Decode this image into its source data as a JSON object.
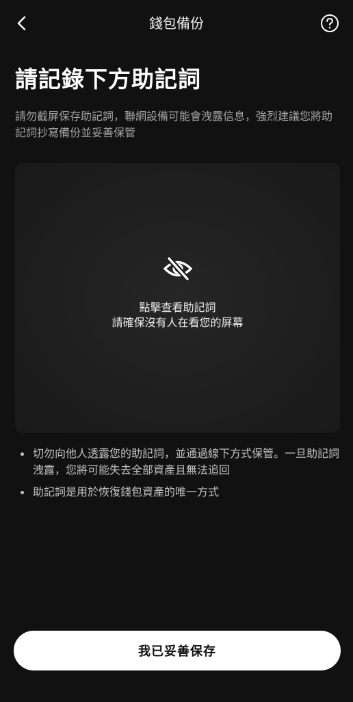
{
  "header": {
    "title": "錢包備份",
    "back_icon": "chevron-left-icon",
    "help_icon": "question-circle-icon"
  },
  "page": {
    "title": "請記錄下方助記詞",
    "subtitle": "請勿截屏保存助記詞，聯網設備可能會洩露信息，強烈建議您將助記詞抄寫備份並妥善保管"
  },
  "reveal_panel": {
    "icon": "eye-off-icon",
    "line1": "點擊查看助記詞",
    "line2": "請確保沒有人在看您的屏幕"
  },
  "tips": [
    {
      "text": "切勿向他人透露您的助記詞，並通過線下方式保管。一旦助記詞洩露，您將可能失去全部資產且無法追回"
    },
    {
      "text": "助記詞是用於恢復錢包資產的唯一方式"
    }
  ],
  "footer": {
    "confirm_label": "我已妥善保存"
  },
  "colors": {
    "background": "#111111",
    "panel": "#1e1e1e",
    "button": "#ffffff",
    "muted_text": "#a6a6a6"
  }
}
